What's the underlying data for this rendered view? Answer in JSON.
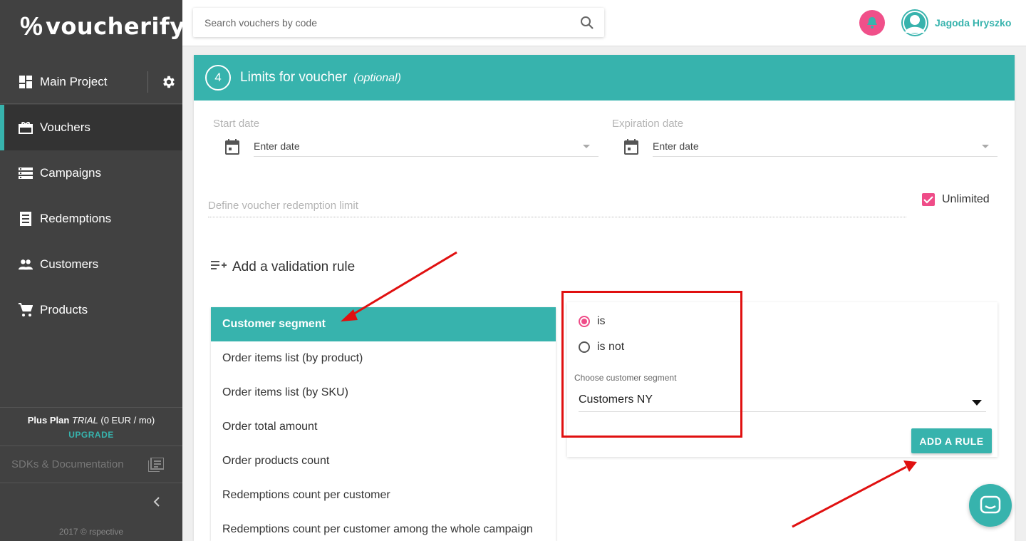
{
  "brand": {
    "logo_text": "voucherify",
    "accent": "#37b3ad",
    "pink": "#ef4c88"
  },
  "sidebar": {
    "project": "Main Project",
    "items": [
      {
        "label": "Vouchers",
        "icon": "gift-icon",
        "active": true
      },
      {
        "label": "Campaigns",
        "icon": "list-icon"
      },
      {
        "label": "Redemptions",
        "icon": "receipt-icon"
      },
      {
        "label": "Customers",
        "icon": "people-icon"
      },
      {
        "label": "Products",
        "icon": "cart-icon"
      }
    ],
    "plan_name": "Plus Plan",
    "plan_trial": "TRIAL",
    "plan_price": "(0 EUR / mo)",
    "upgrade": "UPGRADE",
    "sdk": "SDKs & Documentation",
    "copyright": "2017 © rspective"
  },
  "header": {
    "search_placeholder": "Search vouchers by code",
    "user_name": "Jagoda Hryszko"
  },
  "section": {
    "step": "4",
    "title": "Limits for voucher",
    "optional": "(optional)",
    "start_date_label": "Start date",
    "start_date_value": "Enter date",
    "expiration_label": "Expiration date",
    "expiration_value": "Enter date",
    "redemption_placeholder": "Define voucher redemption limit",
    "unlimited_label": "Unlimited",
    "unlimited_checked": true,
    "add_rule_title": "Add a validation rule"
  },
  "rules": [
    "Customer segment",
    "Order items list (by product)",
    "Order items list (by SKU)",
    "Order total amount",
    "Order products count",
    "Redemptions count per customer",
    "Redemptions count per customer among the whole campaign"
  ],
  "rule_panel": {
    "option_is": "is",
    "option_is_not": "is not",
    "selected": "is",
    "segment_label": "Choose customer segment",
    "segment_value": "Customers NY",
    "add_button": "ADD A RULE"
  }
}
